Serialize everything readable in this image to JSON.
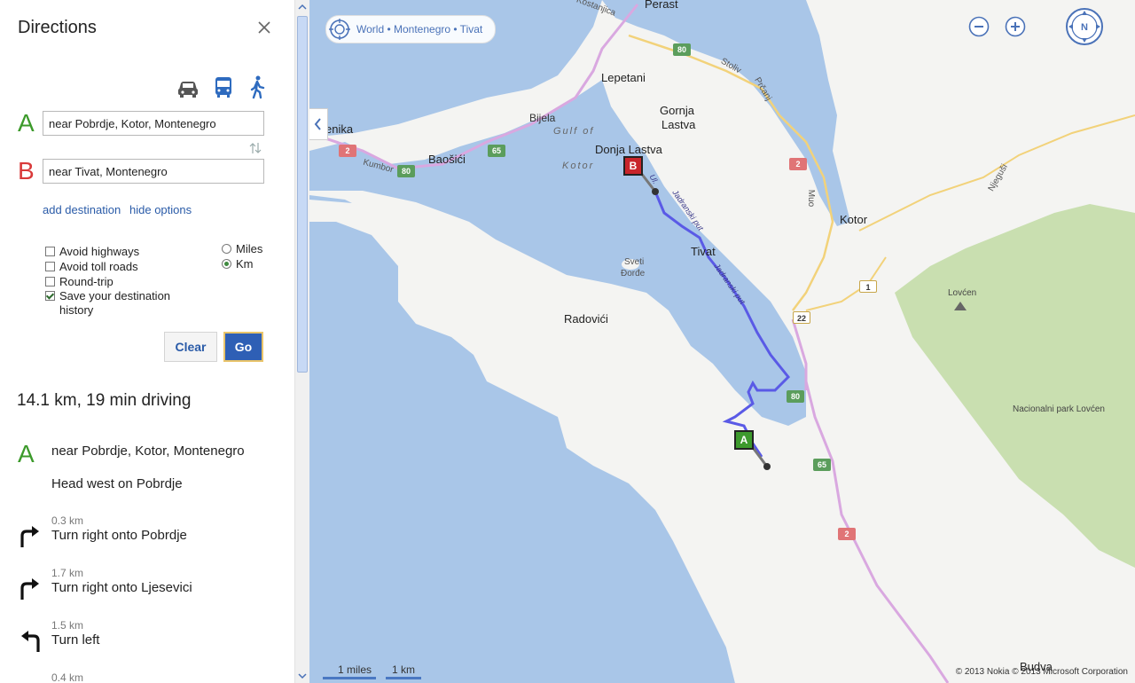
{
  "panel": {
    "title": "Directions",
    "modes": [
      "car-icon",
      "bus-icon",
      "walk-icon"
    ],
    "waypoint_a": {
      "letter": "A",
      "value": "near Pobrdje, Kotor, Montenegro",
      "color": "#3c9a2b"
    },
    "waypoint_b": {
      "letter": "B",
      "value": "near Tivat, Montenegro",
      "color": "#d93a3a"
    },
    "add_destination": "add destination",
    "hide_options": "hide options",
    "options": {
      "avoid_highways": {
        "label": "Avoid highways",
        "checked": false
      },
      "avoid_toll_roads": {
        "label": "Avoid toll roads",
        "checked": false
      },
      "round_trip": {
        "label": "Round-trip",
        "checked": false
      },
      "save_history": {
        "label_line1": "Save your destination",
        "label_line2": "history",
        "checked": true
      }
    },
    "units": {
      "miles": "Miles",
      "km": "Km",
      "selected": "km"
    },
    "clear_label": "Clear",
    "go_label": "Go"
  },
  "route": {
    "summary": "14.1 km, 19 min driving",
    "start_letter": "A",
    "start_name": "near Pobrdje, Kotor, Montenegro",
    "first_instruction": "Head west on Pobrdje",
    "steps": [
      {
        "distance": "0.3 km",
        "instruction": "Turn right onto Pobrdje",
        "icon": "turn-right-icon"
      },
      {
        "distance": "1.7 km",
        "instruction": "Turn right onto Ljesevici",
        "icon": "turn-right-icon"
      },
      {
        "distance": "1.5 km",
        "instruction": "Turn left",
        "icon": "turn-left-icon"
      },
      {
        "distance": "0.4 km",
        "instruction": "",
        "icon": "turn-right-icon"
      }
    ]
  },
  "map": {
    "breadcrumb": "World • Montenegro • Tivat",
    "labels": {
      "perast": "Perast",
      "kostanjica": "Kostanjica",
      "lepetani": "Lepetani",
      "gornja1": "Gornja",
      "gornja2": "Lastva",
      "bijela": "Bijela",
      "gulf_of": "Gulf of",
      "kotor_bay": "Kotor",
      "donja": "Donja Lastva",
      "enika": "enika",
      "baosici": "Baošići",
      "kumbor": "Kumbor",
      "stoliv": "Stoliv",
      "prcanj": "Prčanj",
      "muo": "Muo",
      "kotor": "Kotor",
      "njegusi": "Njeguši",
      "tivat": "Tivat",
      "sveti1": "Sveti",
      "sveti2": "Đorđe",
      "radovici": "Radovići",
      "lovcen": "Lovćen",
      "park": "Nacionalni park Lovćen",
      "budva": "Budva",
      "ulica": "Ul.",
      "jadranski1": "Jadranski put",
      "jadranski2": "Jadranski put"
    },
    "shields": {
      "s80a": "80",
      "s80b": "80",
      "s80c": "80",
      "s65a": "65",
      "s65b": "65",
      "s2a": "2",
      "s2b": "2",
      "s2c": "2",
      "s22": "22",
      "s1": "1"
    },
    "marker_a": "A",
    "marker_b": "B",
    "scale_miles": "1 miles",
    "scale_km": "1 km",
    "copyright": "© 2013 Nokia   © 2013 Microsoft Corporation",
    "compass_letter": "N",
    "colors": {
      "water": "#a9c6e8",
      "land": "#f4f4f2",
      "park": "#c9dfb0",
      "route": "#5a5ae6",
      "road_major": "#d9a8e0",
      "road_secondary": "#f2d27a"
    }
  }
}
